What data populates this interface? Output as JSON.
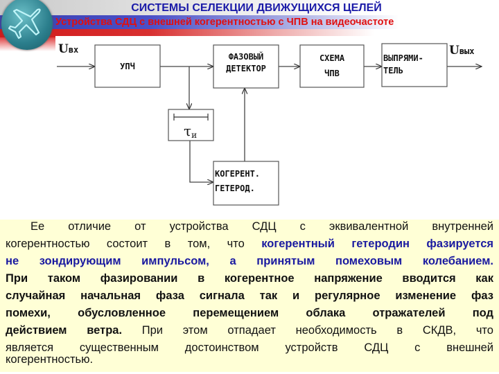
{
  "header": {
    "title": "СИСТЕМЫ СЕЛЕКЦИИ ДВИЖУЩИХСЯ ЦЕЛЕЙ",
    "subtitle": "Устройства СДЦ с внешней когерентностью с ЧПВ на видеочастоте",
    "logo_icon": "airplane-icon"
  },
  "diagram": {
    "input_label": "U",
    "input_sub": "вх",
    "output_label": "U",
    "output_sub": "вых",
    "blocks": {
      "upch": "УПЧ",
      "phase_det_1": "ФАЗОВЫЙ",
      "phase_det_2": "ДЕТЕКТОР",
      "chpv_1": "СХЕМА",
      "chpv_2": "ЧПВ",
      "rect_1": "ВЫПРЯМИ-",
      "rect_2": "ТЕЛЬ",
      "delay": "τ",
      "delay_sub": "и",
      "coh_1": "КОГЕРЕНТ.",
      "coh_2": "ГЕТЕРОД."
    }
  },
  "text": {
    "l1": "Ее отличие от устройства СДЦ с эквивалентной внутренней",
    "l2a": "когерентностью состоит в том, что ",
    "l2b": "когерентный гетеродин фазируется",
    "l3": "не зондирующим импульсом, а принятым помеховым колебанием.",
    "l4": "При таком фазировании в когерентное напряжение вводится как",
    "l5": "случайная начальная фаза сигнала так и регулярное изменение фаз",
    "l6": "помехи, обусловленное перемещением облака отражателей под",
    "l7a": "действием ветра.",
    "l7b": " При этом отпадает необходимость в СКДВ, что",
    "l8": "является существенным достоинством устройств СДЦ с внешней",
    "l9": "когерентностью."
  },
  "colors": {
    "title": "#1a1aa8",
    "subtitle": "#e01010",
    "highlight": "#1a1aa0",
    "text_bg": "#ffffd6"
  }
}
